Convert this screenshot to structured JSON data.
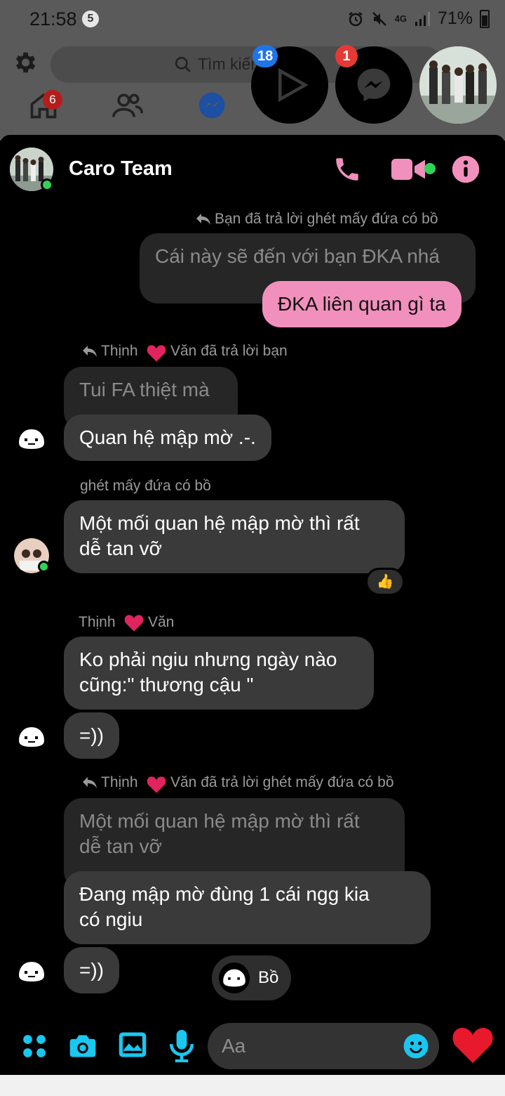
{
  "status_bar": {
    "time": "21:58",
    "notif_count": "5",
    "network": "4G",
    "battery": "71%"
  },
  "fb_background": {
    "search_placeholder": "Tìm kiếm",
    "search_suffix": "n",
    "home_badge": "6"
  },
  "chat_heads": {
    "video_badge": "18",
    "messenger_badge": "1"
  },
  "conversation": {
    "title": "Caro Team",
    "accent_color": "#f290bd"
  },
  "messages": {
    "reply1_note": "Bạn đã trả lời ghét mấy đứa có bồ",
    "reply1_quoted": "Cái này sẽ đến với bạn ĐKA nhá",
    "reply1_text": "ĐKA liên quan gì ta",
    "reply2_note_a": "Thịnh",
    "reply2_note_b": "Văn đã trả lời bạn",
    "reply2_quoted": "Tui FA thiệt mà",
    "reply2_text": "Quan hệ mập mờ .-.",
    "sender3": "ghét mấy đứa có bồ",
    "msg3_line1": "Một mối quan hệ mập mờ thì rất",
    "msg3_line2": "dễ tan vỡ",
    "msg3_reaction": "👍",
    "sender4_a": "Thịnh",
    "sender4_b": "Văn",
    "msg4_line1": "Ko phải ngiu nhưng ngày nào",
    "msg4_line2": "cũng:\" thương cậu \"",
    "msg5": "=))",
    "reply6_note_a": "Thịnh",
    "reply6_note_b": "Văn đã trả lời ghét mấy đứa có bồ",
    "reply6_quoted_line1": "Một mối quan hệ mập mờ thì rất",
    "reply6_quoted_line2": "dễ tan vỡ",
    "reply6_line1": "Đang mập mờ đùng 1 cái ngg kia",
    "reply6_line2": "có ngiu",
    "msg7": "=))",
    "seen_name": "Bồ"
  },
  "composer": {
    "placeholder": "Aa",
    "heart": "❤️"
  }
}
